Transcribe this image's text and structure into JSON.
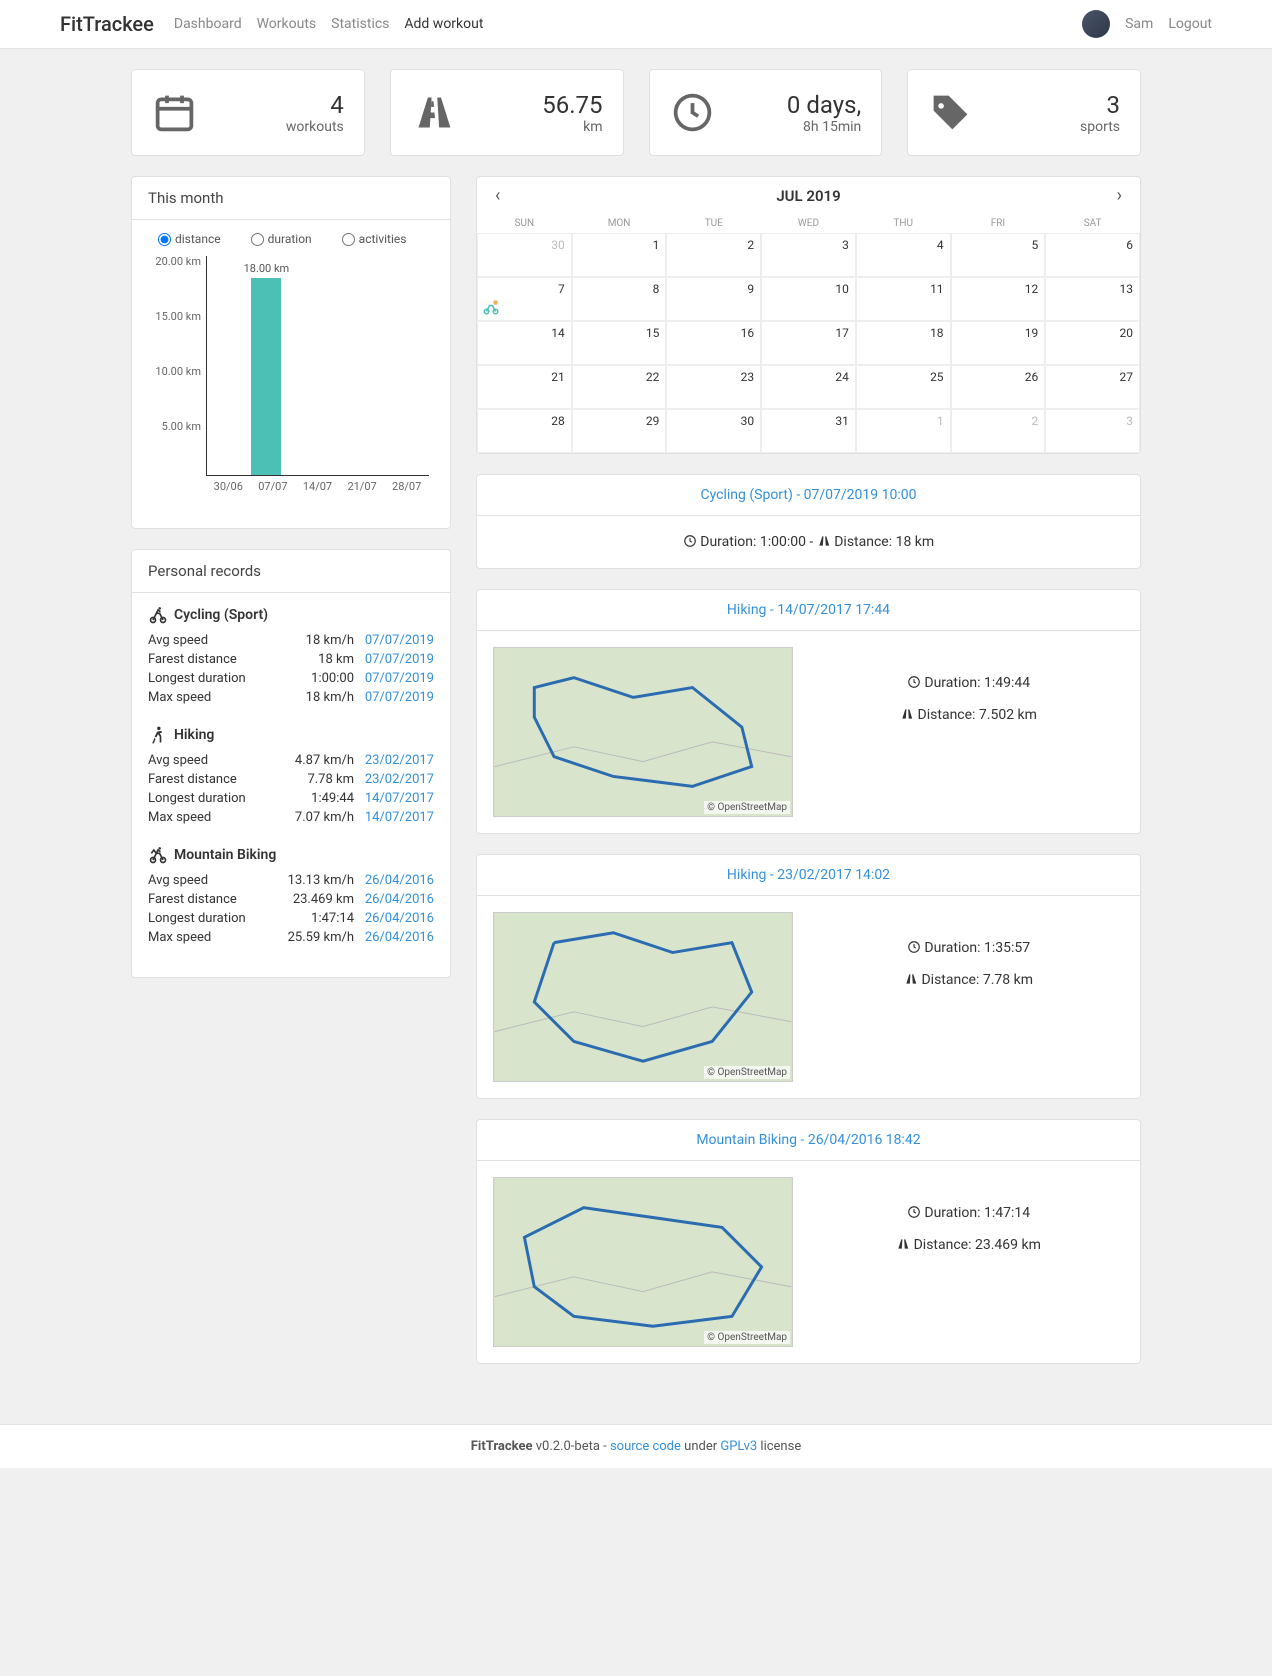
{
  "brand": "FitTrackee",
  "nav": {
    "dashboard": "Dashboard",
    "workouts": "Workouts",
    "statistics": "Statistics",
    "add_workout": "Add workout",
    "user": "Sam",
    "logout": "Logout"
  },
  "stats": {
    "workouts": {
      "value": "4",
      "label": "workouts"
    },
    "distance": {
      "value": "56.75",
      "label": "km"
    },
    "duration": {
      "value": "0 days,",
      "label": "8h 15min"
    },
    "sports": {
      "value": "3",
      "label": "sports"
    }
  },
  "month_chart": {
    "title": "This month",
    "radios": {
      "distance": "distance",
      "duration": "duration",
      "activities": "activities"
    },
    "bar_label": "18.00 km",
    "y_ticks": [
      "20.00 km",
      "15.00 km",
      "10.00 km",
      "5.00 km"
    ],
    "x_ticks": [
      "30/06",
      "07/07",
      "14/07",
      "21/07",
      "28/07"
    ]
  },
  "chart_data": {
    "type": "bar",
    "title": "This month",
    "categories": [
      "30/06",
      "07/07",
      "14/07",
      "21/07",
      "28/07"
    ],
    "values": [
      0,
      18.0,
      0,
      0,
      0
    ],
    "ylabel": "km",
    "ylim": [
      0,
      20
    ],
    "y_ticks": [
      5,
      10,
      15,
      20
    ]
  },
  "records": {
    "title": "Personal records",
    "sports": [
      {
        "name": "Cycling (Sport)",
        "rows": [
          {
            "metric": "Avg speed",
            "value": "18 km/h",
            "date": "07/07/2019"
          },
          {
            "metric": "Farest distance",
            "value": "18 km",
            "date": "07/07/2019"
          },
          {
            "metric": "Longest duration",
            "value": "1:00:00",
            "date": "07/07/2019"
          },
          {
            "metric": "Max speed",
            "value": "18 km/h",
            "date": "07/07/2019"
          }
        ]
      },
      {
        "name": "Hiking",
        "rows": [
          {
            "metric": "Avg speed",
            "value": "4.87 km/h",
            "date": "23/02/2017"
          },
          {
            "metric": "Farest distance",
            "value": "7.78 km",
            "date": "23/02/2017"
          },
          {
            "metric": "Longest duration",
            "value": "1:49:44",
            "date": "14/07/2017"
          },
          {
            "metric": "Max speed",
            "value": "7.07 km/h",
            "date": "14/07/2017"
          }
        ]
      },
      {
        "name": "Mountain Biking",
        "rows": [
          {
            "metric": "Avg speed",
            "value": "13.13 km/h",
            "date": "26/04/2016"
          },
          {
            "metric": "Farest distance",
            "value": "23.469 km",
            "date": "26/04/2016"
          },
          {
            "metric": "Longest duration",
            "value": "1:47:14",
            "date": "26/04/2016"
          },
          {
            "metric": "Max speed",
            "value": "25.59 km/h",
            "date": "26/04/2016"
          }
        ]
      }
    ]
  },
  "calendar": {
    "title": "JUL 2019",
    "daynames": [
      "SUN",
      "MON",
      "TUE",
      "WED",
      "THU",
      "FRI",
      "SAT"
    ],
    "weeks": [
      [
        {
          "d": "30",
          "o": true
        },
        {
          "d": "1"
        },
        {
          "d": "2"
        },
        {
          "d": "3"
        },
        {
          "d": "4"
        },
        {
          "d": "5"
        },
        {
          "d": "6"
        }
      ],
      [
        {
          "d": "7",
          "icon": true
        },
        {
          "d": "8"
        },
        {
          "d": "9"
        },
        {
          "d": "10"
        },
        {
          "d": "11"
        },
        {
          "d": "12"
        },
        {
          "d": "13"
        }
      ],
      [
        {
          "d": "14"
        },
        {
          "d": "15"
        },
        {
          "d": "16"
        },
        {
          "d": "17"
        },
        {
          "d": "18"
        },
        {
          "d": "19"
        },
        {
          "d": "20"
        }
      ],
      [
        {
          "d": "21"
        },
        {
          "d": "22"
        },
        {
          "d": "23"
        },
        {
          "d": "24"
        },
        {
          "d": "25"
        },
        {
          "d": "26"
        },
        {
          "d": "27"
        }
      ],
      [
        {
          "d": "28"
        },
        {
          "d": "29"
        },
        {
          "d": "30"
        },
        {
          "d": "31"
        },
        {
          "d": "1",
          "o": true
        },
        {
          "d": "2",
          "o": true
        },
        {
          "d": "3",
          "o": true
        }
      ]
    ]
  },
  "workouts": [
    {
      "title": "Cycling (Sport) - 07/07/2019 10:00",
      "simple": true,
      "duration_label": "Duration:",
      "duration": "1:00:00",
      "distance_label": "Distance:",
      "distance": "18 km"
    },
    {
      "title": "Hiking - 14/07/2017 17:44",
      "duration_label": "Duration:",
      "duration": "1:49:44",
      "distance_label": "Distance:",
      "distance": "7.502 km"
    },
    {
      "title": "Hiking - 23/02/2017 14:02",
      "duration_label": "Duration:",
      "duration": "1:35:57",
      "distance_label": "Distance:",
      "distance": "7.78 km"
    },
    {
      "title": "Mountain Biking - 26/04/2016 18:42",
      "duration_label": "Duration:",
      "duration": "1:47:14",
      "distance_label": "Distance:",
      "distance": "23.469 km"
    }
  ],
  "map_credit": "© OpenStreetMap",
  "footer": {
    "brand": "FitTrackee",
    "version": " v0.2.0-beta - ",
    "source": "source code",
    "under": " under ",
    "license_name": "GPLv3",
    "license_suffix": " license"
  }
}
